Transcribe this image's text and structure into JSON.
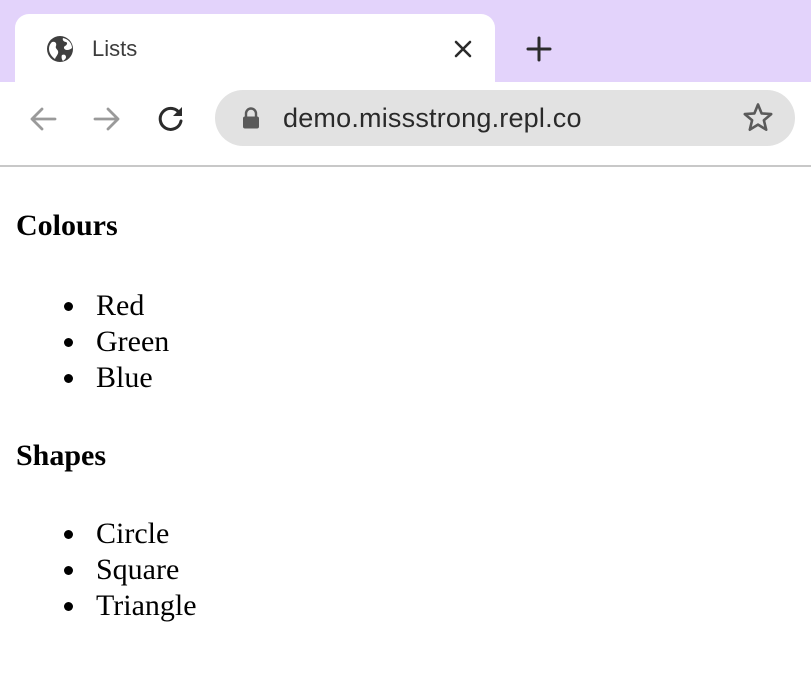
{
  "browser": {
    "tab": {
      "title": "Lists",
      "favicon": "globe-icon",
      "close_icon": "close-icon"
    },
    "new_tab_icon": "plus-icon",
    "nav": {
      "back_icon": "arrow-left-icon",
      "forward_icon": "arrow-right-icon",
      "reload_icon": "reload-icon"
    },
    "address_bar": {
      "url": "demo.missstrong.repl.co",
      "lock_icon": "lock-icon",
      "bookmark_icon": "star-icon"
    },
    "colors": {
      "tabstrip": "#e3d3fb",
      "omnibox": "#e2e2e2"
    }
  },
  "page": {
    "sections": [
      {
        "heading": "Colours",
        "items": [
          "Red",
          "Green",
          "Blue"
        ]
      },
      {
        "heading": "Shapes",
        "items": [
          "Circle",
          "Square",
          "Triangle"
        ]
      }
    ]
  }
}
